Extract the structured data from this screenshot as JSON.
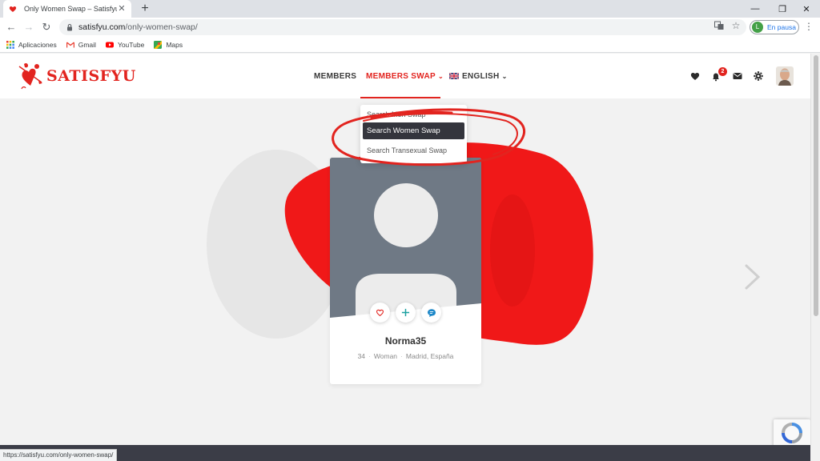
{
  "browser": {
    "tab_title": "Only Women Swap – Satisfyu",
    "url_host": "satisfyu.com",
    "url_path": "/only-women-swap/",
    "profile_initial": "L",
    "profile_label": "En pausa",
    "bookmarks": [
      "Aplicaciones",
      "Gmail",
      "YouTube",
      "Maps"
    ],
    "status_url": "https://satisfyu.com/only-women-swap/"
  },
  "site": {
    "logo_text": "SATISFYU",
    "nav": {
      "members": "MEMBERS",
      "members_swap": "MEMBERS SWAP",
      "language": "ENGLISH"
    },
    "notification_count": "2",
    "dropdown": {
      "items": [
        "Search Men Swap",
        "Search Women Swap",
        "Search Transexual Swap"
      ],
      "active_index": 1
    },
    "profile_card": {
      "name": "Norma35",
      "age": "34",
      "gender": "Woman",
      "location": "Madrid, España"
    }
  },
  "colors": {
    "brand_red": "#e2241f",
    "dark": "#34353d",
    "card_photo": "#6f7985"
  }
}
